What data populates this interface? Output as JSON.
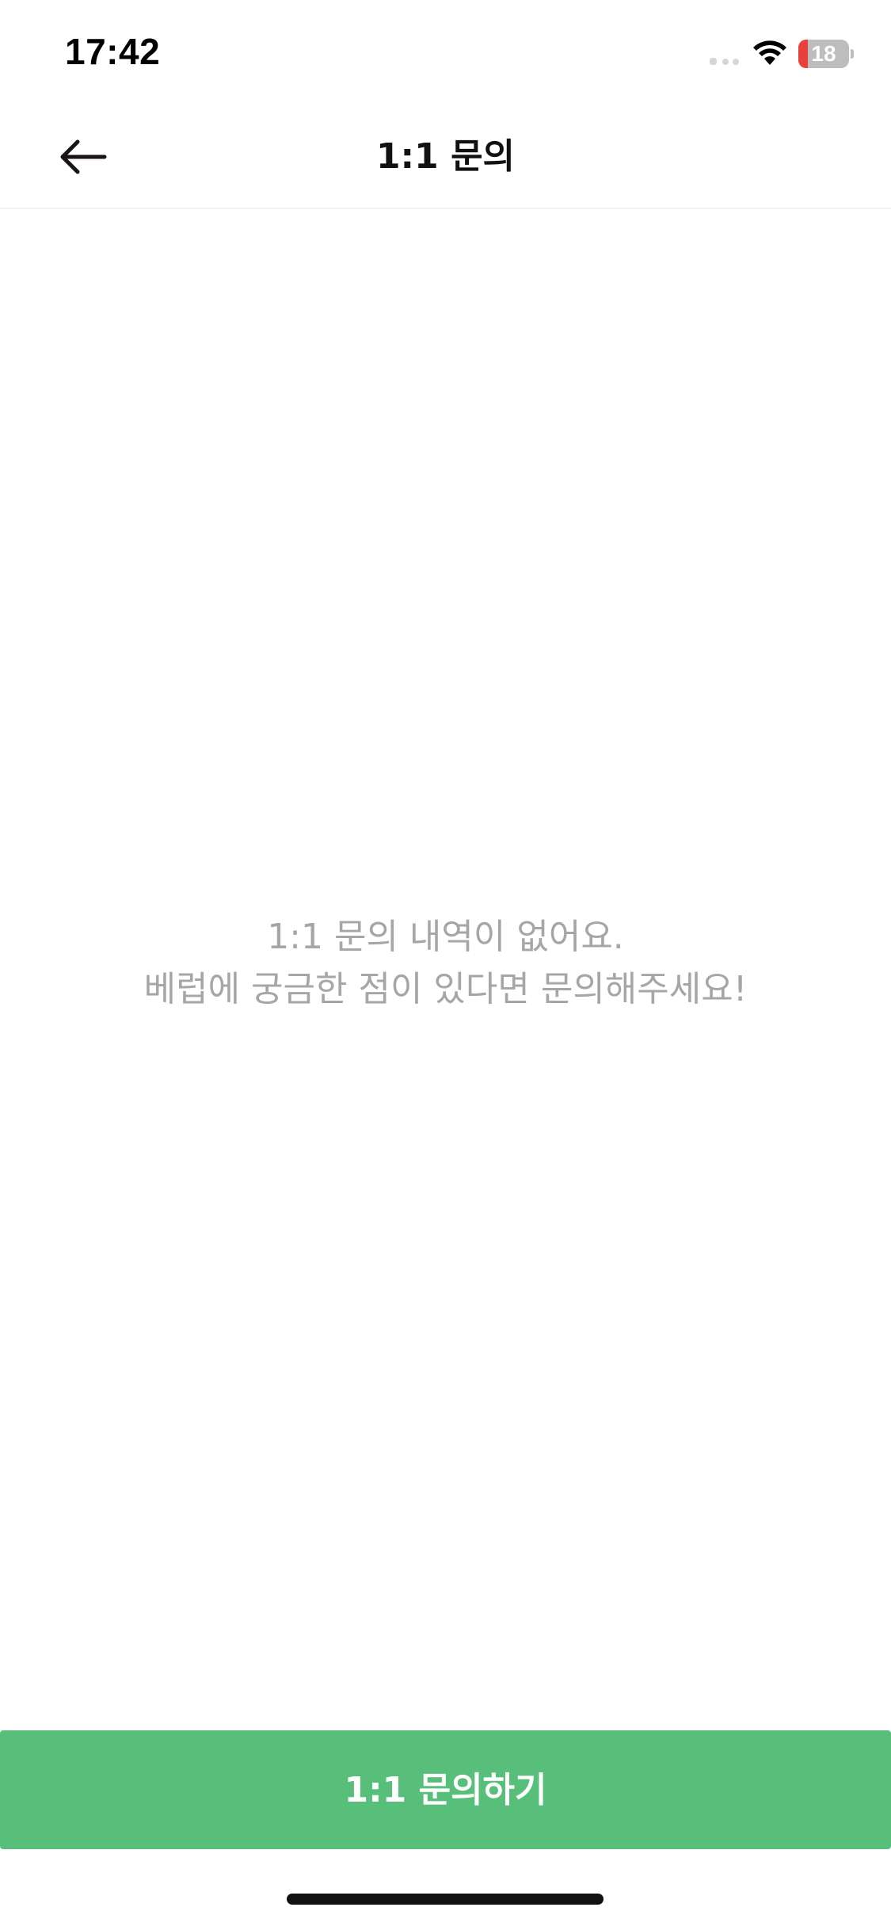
{
  "status_bar": {
    "time": "17:42",
    "battery_level": "18",
    "battery_fraction": 0.18,
    "battery_color": "#e8413b",
    "icons": [
      "signal-icon",
      "wifi-icon",
      "battery-icon"
    ]
  },
  "header": {
    "title": "1:1 문의",
    "back_icon": "arrow-left-icon"
  },
  "empty_state": {
    "line1": "1:1 문의 내역이 없어요.",
    "line2": "베럽에 궁금한 점이 있다면 문의해주세요!"
  },
  "cta": {
    "label": "1:1 문의하기",
    "color": "#58bf7b"
  },
  "colors": {
    "empty_text": "#a6a6a6",
    "title": "#111111",
    "background": "#ffffff"
  }
}
